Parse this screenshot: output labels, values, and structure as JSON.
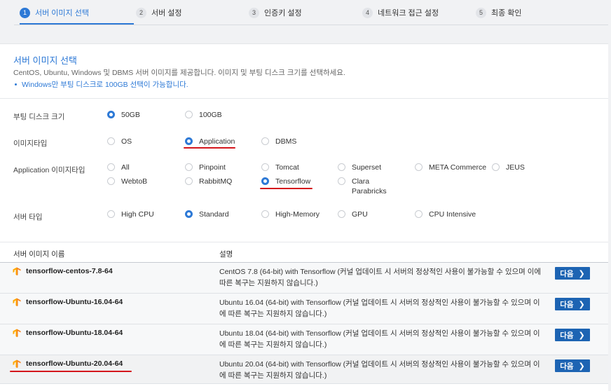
{
  "steps": [
    {
      "num": "1",
      "label": "서버 이미지 선택"
    },
    {
      "num": "2",
      "label": "서버 설정"
    },
    {
      "num": "3",
      "label": "인증키 설정"
    },
    {
      "num": "4",
      "label": "네트워크 접근 설정"
    },
    {
      "num": "5",
      "label": "최종 확인"
    }
  ],
  "intro": {
    "title": "서버 이미지 선택",
    "description": "CentOS, Ubuntu, Windows 및 DBMS 서버 이미지를 제공합니다. 이미지 및 부팅 디스크 크기를 선택하세요.",
    "note": "Windows만 부팅 디스크로 100GB 선택이 가능합니다."
  },
  "boot_disk": {
    "label": "부팅 디스크 크기",
    "options": [
      "50GB",
      "100GB"
    ],
    "selected": "50GB"
  },
  "image_type": {
    "label": "이미지타입",
    "options": [
      "OS",
      "Application",
      "DBMS"
    ],
    "selected": "Application"
  },
  "app_image_type": {
    "label": "Application 이미지타입",
    "options": [
      "All",
      "Pinpoint",
      "Tomcat",
      "Superset",
      "META Commerce",
      "JEUS",
      "WebtoB",
      "RabbitMQ",
      "Tensorflow",
      "Clara Parabricks"
    ],
    "selected": "Tensorflow"
  },
  "server_type": {
    "label": "서버 타입",
    "options": [
      "High CPU",
      "Standard",
      "High-Memory",
      "GPU",
      "CPU Intensive"
    ],
    "selected": "Standard"
  },
  "table": {
    "col_name": "서버 이미지 이름",
    "col_desc": "설명",
    "next_label": "다음",
    "rows": [
      {
        "name": "tensorflow-centos-7.8-64",
        "desc": "CentOS 7.8 (64-bit) with Tensorflow (커널 업데이트 시 서버의 정상적인 사용이 불가능할 수 있으며 이에 따른 복구는 지원하지 않습니다.)"
      },
      {
        "name": "tensorflow-Ubuntu-16.04-64",
        "desc": "Ubuntu 16.04 (64-bit) with Tensorflow (커널 업데이트 시 서버의 정상적인 사용이 불가능할 수 있으며 이에 따른 복구는 지원하지 않습니다.)"
      },
      {
        "name": "tensorflow-Ubuntu-18.04-64",
        "desc": "Ubuntu 18.04 (64-bit) with Tensorflow (커널 업데이트 시 서버의 정상적인 사용이 불가능할 수 있으며 이에 따른 복구는 지원하지 않습니다.)"
      },
      {
        "name": "tensorflow-Ubuntu-20.04-64",
        "desc": "Ubuntu 20.04 (64-bit) with Tensorflow (커널 업데이트 시 서버의 정상적인 사용이 불가능할 수 있으며 이에 따른 복구는 지원하지 않습니다.)"
      }
    ]
  },
  "colors": {
    "accent": "#2d79d6",
    "button": "#1d64b3",
    "highlight": "#d4161c",
    "tensorflow_icon": "#f58220"
  }
}
